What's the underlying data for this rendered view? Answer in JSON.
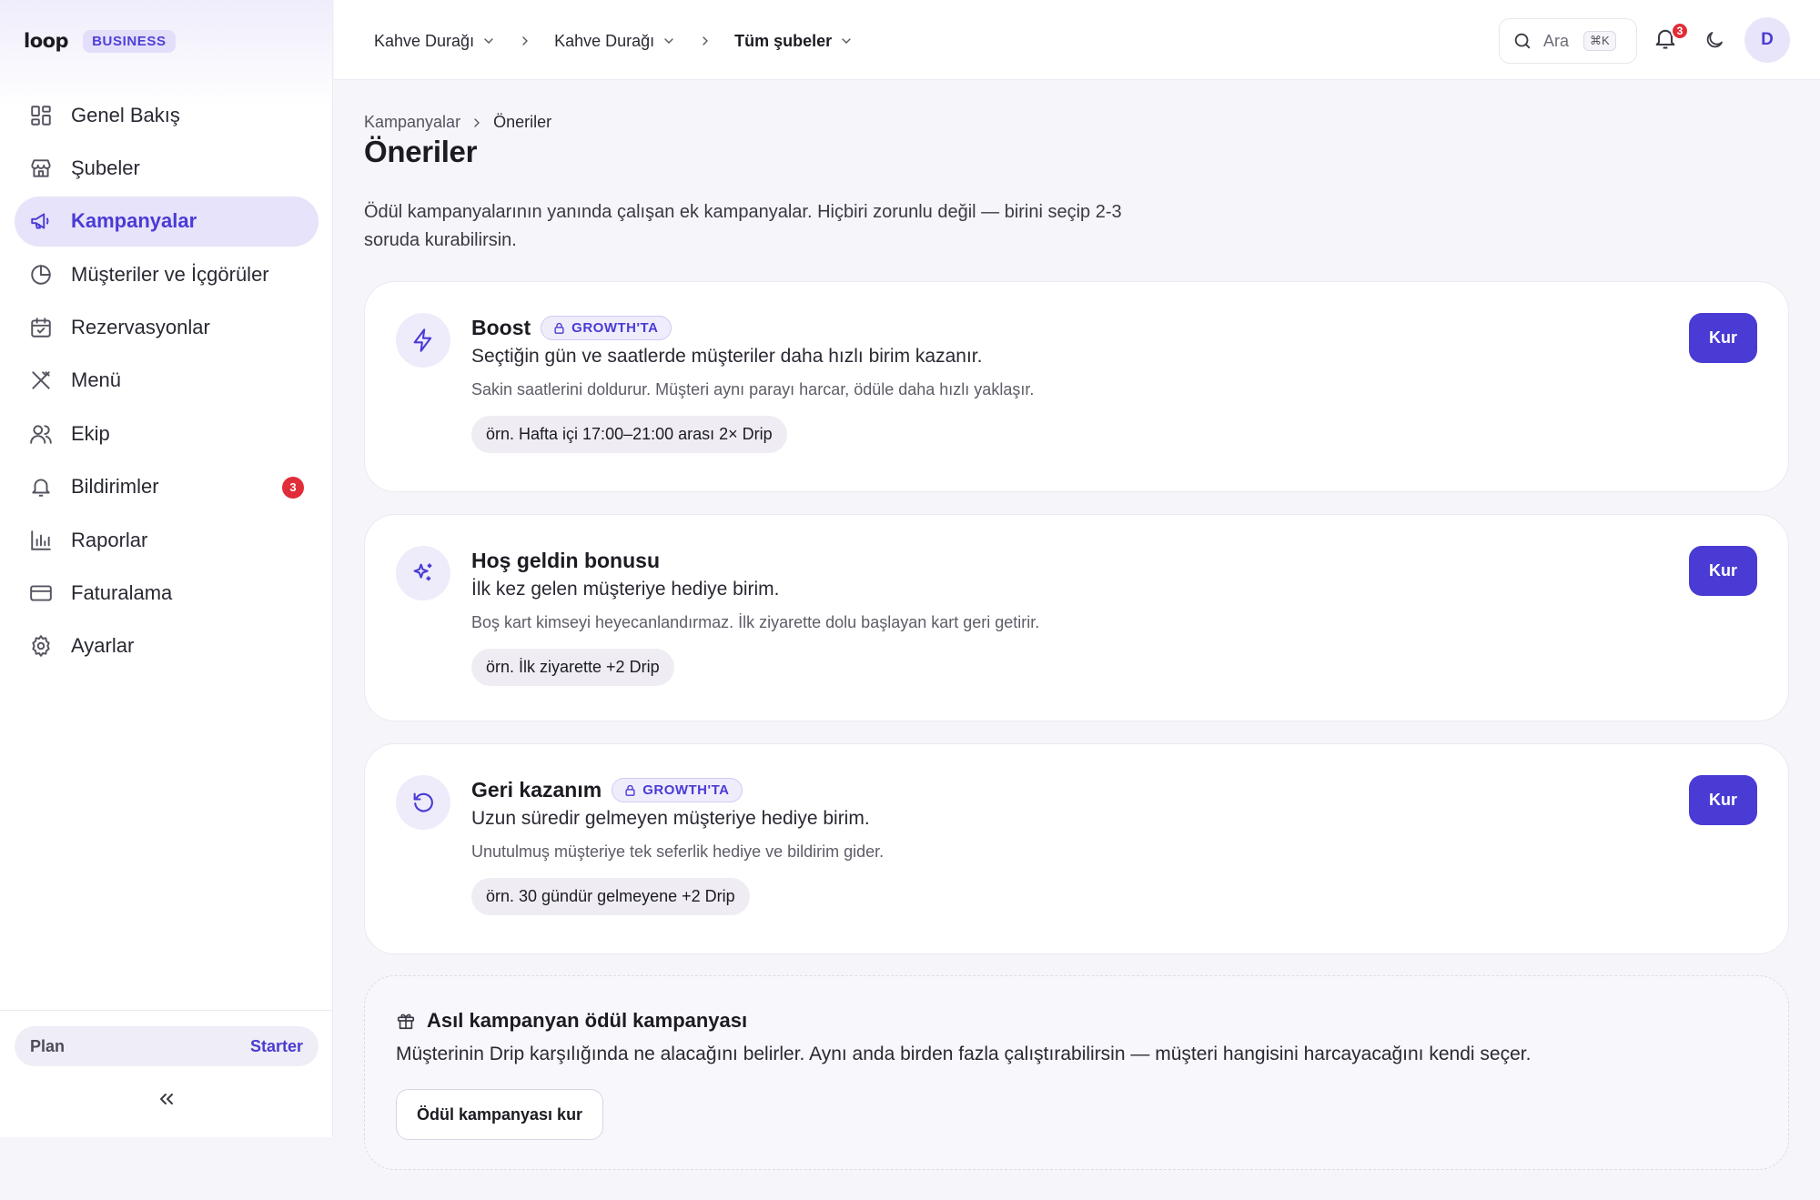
{
  "brand": {
    "logo": "loop",
    "badge": "BUSINESS"
  },
  "sidebar": {
    "items": [
      {
        "label": "Genel Bakış",
        "icon": "layout-grid-icon"
      },
      {
        "label": "Şubeler",
        "icon": "store-icon"
      },
      {
        "label": "Kampanyalar",
        "icon": "megaphone-icon",
        "active": true
      },
      {
        "label": "Müşteriler ve İçgörüler",
        "icon": "pie-chart-icon"
      },
      {
        "label": "Rezervasyonlar",
        "icon": "calendar-icon"
      },
      {
        "label": "Menü",
        "icon": "utensils-icon"
      },
      {
        "label": "Ekip",
        "icon": "users-icon"
      },
      {
        "label": "Bildirimler",
        "icon": "bell-icon",
        "badge": "3"
      },
      {
        "label": "Raporlar",
        "icon": "bar-chart-icon"
      },
      {
        "label": "Faturalama",
        "icon": "credit-card-icon"
      },
      {
        "label": "Ayarlar",
        "icon": "gear-icon"
      }
    ],
    "plan": {
      "label": "Plan",
      "value": "Starter"
    },
    "collapse": "«"
  },
  "topbar": {
    "crumbs": [
      "Kahve Durağı",
      "Kahve Durağı",
      "Tüm şubeler"
    ],
    "search": {
      "placeholder": "Ara",
      "shortcut": "⌘K"
    },
    "notifications": "3",
    "avatar": "D"
  },
  "page": {
    "breadcrumb": [
      "Kampanyalar",
      "Öneriler"
    ],
    "title": "Öneriler",
    "description": "Ödül kampanyalarının yanında çalışan ek kampanyalar. Hiçbiri zorunlu değil — birini seçip 2-3 soruda kurabilirsin."
  },
  "cards": [
    {
      "title": "Boost",
      "badge": "GROWTH'TA",
      "subtitle": "Seçtiğin gün ve saatlerde müşteriler daha hızlı birim kazanır.",
      "note": "Sakin saatlerini doldurur. Müşteri aynı parayı harcar, ödüle daha hızlı yaklaşır.",
      "example": "örn. Hafta içi 17:00–21:00 arası 2× Drip",
      "button": "Kur",
      "icon": "lightning-icon"
    },
    {
      "title": "Hoş geldin bonusu",
      "badge": "",
      "subtitle": "İlk kez gelen müşteriye hediye birim.",
      "note": "Boş kart kimseyi heyecanlandırmaz. İlk ziyarette dolu başlayan kart geri getirir.",
      "example": "örn. İlk ziyarette +2 Drip",
      "button": "Kur",
      "icon": "sparkles-icon"
    },
    {
      "title": "Geri kazanım",
      "badge": "GROWTH'TA",
      "subtitle": "Uzun süredir gelmeyen müşteriye hediye birim.",
      "note": "Unutulmuş müşteriye tek seferlik hediye ve bildirim gider.",
      "example": "örn. 30 gündür gelmeyene +2 Drip",
      "button": "Kur",
      "icon": "rotate-ccw-icon"
    }
  ],
  "reward": {
    "title": "Asıl kampanyan ödül kampanyası",
    "description": "Müşterinin Drip karşılığında ne alacağını belirler. Aynı anda birden fazla çalıştırabilirsin — müşteri hangisini harcayacağını kendi seçer.",
    "button": "Ödül kampanyası kur",
    "icon": "gift-icon"
  },
  "colors": {
    "accent": "#4a3bd4",
    "accent_soft": "#e6e3fa",
    "badge_red": "#e12d39",
    "background": "#f6f5fa"
  }
}
